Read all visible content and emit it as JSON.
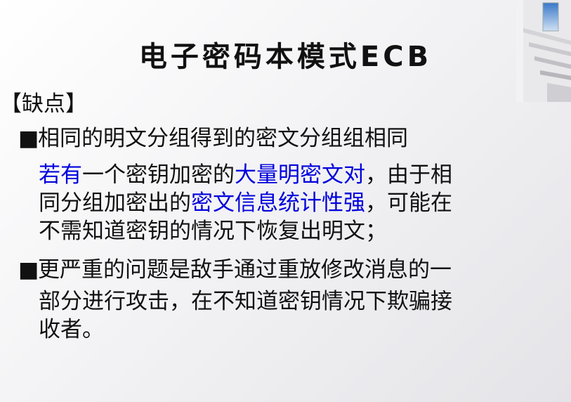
{
  "slide": {
    "title": "电子密码本模式ECB",
    "section_label": "【缺点】",
    "bullet_marker": "■",
    "bullet1": "相同的明文分组得到的密文分组组相同",
    "para1": {
      "line1": {
        "s1": "若有",
        "s2": "一个密钥加密的",
        "s3": "大量明密文对",
        "s4": "，由于相"
      },
      "line2": {
        "s1": "同分组加密出的",
        "s2": "密文信息统计性强",
        "s3": "，可能在"
      },
      "line3": "不需知道密钥的情况下恢复出明文；"
    },
    "bullet2": {
      "line1": "更严重的问题是敌手通过重放修改消息的一",
      "line2": "部分进行攻击，在不知道密钥情况下欺骗接",
      "line3": "收者。"
    },
    "colors": {
      "highlight": "#0000dd",
      "text": "#111111"
    }
  }
}
